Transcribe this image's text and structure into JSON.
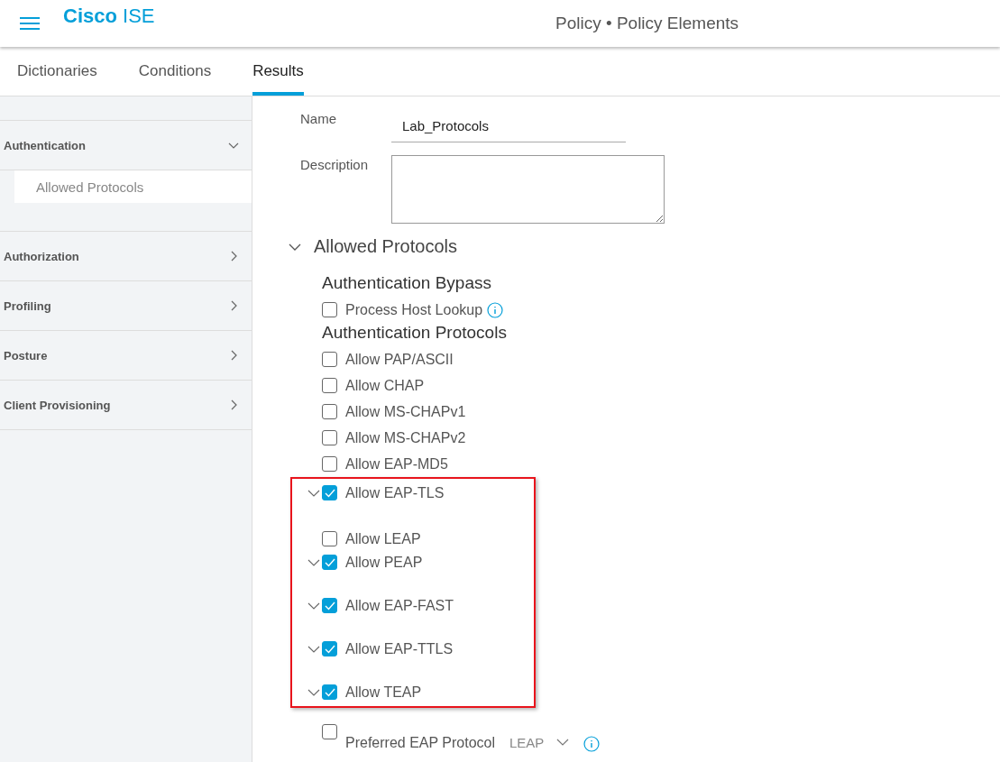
{
  "header": {
    "brand_bold": "Cisco",
    "brand_light": "ISE",
    "title": "Policy • Policy Elements"
  },
  "tabs": [
    {
      "label": "Dictionaries",
      "selected": false
    },
    {
      "label": "Conditions",
      "selected": false
    },
    {
      "label": "Results",
      "selected": true
    }
  ],
  "sidebar": {
    "sections": [
      {
        "label": "Authentication",
        "expanded": true,
        "children": [
          {
            "label": "Allowed Protocols",
            "selected": true
          }
        ]
      },
      {
        "label": "Authorization",
        "expanded": false
      },
      {
        "label": "Profiling",
        "expanded": false
      },
      {
        "label": "Posture",
        "expanded": false
      },
      {
        "label": "Client Provisioning",
        "expanded": false
      }
    ]
  },
  "form": {
    "name_label": "Name",
    "name_value": "Lab_Protocols",
    "description_label": "Description"
  },
  "allowed_protocols": {
    "heading": "Allowed Protocols",
    "expanded": true,
    "bypass_heading": "Authentication Bypass",
    "bypass": [
      {
        "label": "Process Host Lookup",
        "checked": false,
        "info": true
      }
    ],
    "protocols_heading": "Authentication Protocols",
    "protocols": [
      {
        "label": "Allow PAP/ASCII",
        "checked": false,
        "expandable": false
      },
      {
        "label": "Allow CHAP",
        "checked": false,
        "expandable": false
      },
      {
        "label": "Allow MS-CHAPv1",
        "checked": false,
        "expandable": false
      },
      {
        "label": "Allow MS-CHAPv2",
        "checked": false,
        "expandable": false
      },
      {
        "label": "Allow EAP-MD5",
        "checked": false,
        "expandable": false
      }
    ],
    "highlighted_protocols": [
      {
        "label": "Allow EAP-TLS",
        "checked": true,
        "expandable": true
      },
      {
        "label": "Allow LEAP",
        "checked": false,
        "expandable": false
      },
      {
        "label": "Allow PEAP",
        "checked": true,
        "expandable": true
      },
      {
        "label": "Allow EAP-FAST",
        "checked": true,
        "expandable": true
      },
      {
        "label": "Allow EAP-TTLS",
        "checked": true,
        "expandable": true
      },
      {
        "label": "Allow TEAP",
        "checked": true,
        "expandable": true
      }
    ],
    "preferred": {
      "label": "Preferred EAP Protocol",
      "checked": false,
      "value": "LEAP"
    }
  }
}
